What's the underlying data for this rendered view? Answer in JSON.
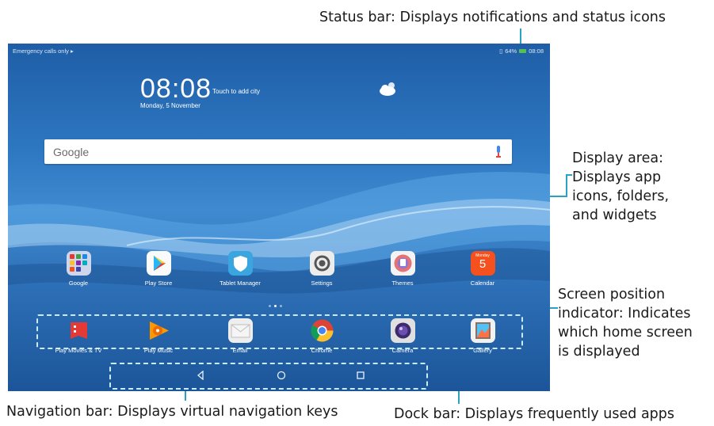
{
  "callouts": {
    "status_bar": "Status bar: Displays notifications and status icons",
    "display_area": [
      "Display area:",
      "Displays app",
      "icons, folders,",
      "and widgets"
    ],
    "screen_position": [
      "Screen position",
      "indicator: Indicates",
      "which home screen",
      "is displayed"
    ],
    "navigation_bar": "Navigation bar: Displays virtual navigation keys",
    "dock_bar": "Dock bar: Displays frequently used apps"
  },
  "status": {
    "left": "Emergency calls only",
    "right": "64%",
    "time": "08:08"
  },
  "widget": {
    "clock": "08:08",
    "touch_city": "Touch to add city",
    "date": "Monday, 5 November"
  },
  "search": {
    "logo": "Google"
  },
  "apps": [
    {
      "label": "Google",
      "icon": "google-folder-icon"
    },
    {
      "label": "Play Store",
      "icon": "play-store-icon"
    },
    {
      "label": "Tablet Manager",
      "icon": "tablet-manager-icon"
    },
    {
      "label": "Settings",
      "icon": "settings-icon"
    },
    {
      "label": "Themes",
      "icon": "themes-icon"
    },
    {
      "label": "Calendar",
      "icon": "calendar-icon",
      "badge_top": "Monday",
      "badge_num": "5"
    }
  ],
  "dock": [
    {
      "label": "Play Movies & TV",
      "icon": "play-movies-icon"
    },
    {
      "label": "Play Music",
      "icon": "play-music-icon"
    },
    {
      "label": "Email",
      "icon": "email-icon"
    },
    {
      "label": "Chrome",
      "icon": "chrome-icon"
    },
    {
      "label": "Camera",
      "icon": "camera-icon"
    },
    {
      "label": "Gallery",
      "icon": "gallery-icon"
    }
  ],
  "colors": {
    "callout_line": "#2aa3c2",
    "dash": "#c9ecf6",
    "wallpaper": "#2d77c1"
  }
}
